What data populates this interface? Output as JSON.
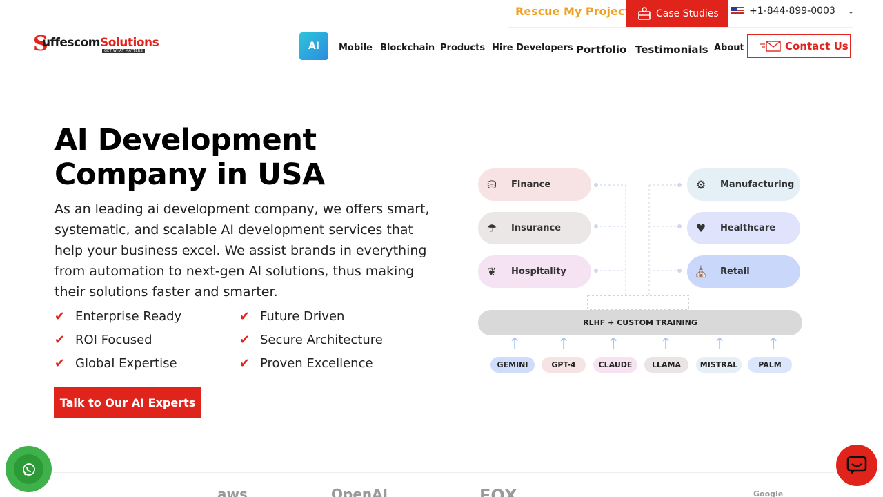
{
  "topbar": {
    "rescue_label": "Rescue My Project",
    "case_studies_label": "Case Studies",
    "phone": "+1-844-899-0003"
  },
  "logo": {
    "s": "S",
    "name": "uffescom",
    "name_accent": "Solutions",
    "tagline": "GET WHAT MATTERS"
  },
  "nav": {
    "ai": "AI",
    "mobile": "Mobile",
    "blockchain": "Blockchain",
    "products": "Products",
    "hire": "Hire Developers",
    "portfolio": "Portfolio",
    "testimonials": "Testimonials",
    "about": "About",
    "contact": "Contact Us"
  },
  "hero": {
    "title": "AI Development Company in USA",
    "description": "As an leading ai development company, we offers smart, systematic, and scalable AI development services that help your business excel. We assist brands in everything from automation to next-gen AI solutions, thus making their solutions faster and smarter.",
    "features": [
      "Enterprise Ready",
      "Future Driven",
      "ROI Focused",
      "Secure Architecture",
      "Global Expertise",
      "Proven Excellence"
    ],
    "cta": "Talk to Our AI Experts"
  },
  "diagram": {
    "left": [
      {
        "label": "Finance",
        "icon": "coins-icon",
        "color": "#f7e3e3"
      },
      {
        "label": "Insurance",
        "icon": "umbrella-icon",
        "color": "#ebe7e7"
      },
      {
        "label": "Hospitality",
        "icon": "hands-icon",
        "color": "#f5e3f3"
      }
    ],
    "right": [
      {
        "label": "Manufacturing",
        "icon": "factory-icon",
        "color": "#e5eff6"
      },
      {
        "label": "Healthcare",
        "icon": "heart-pulse-icon",
        "color": "#dfe3fb"
      },
      {
        "label": "Retail",
        "icon": "store-icon",
        "color": "#c9d7fb"
      }
    ],
    "training": "RLHF + CUSTOM TRAINING",
    "models": [
      {
        "label": "GEMINI",
        "color": "#cfdcfa"
      },
      {
        "label": "GPT-4",
        "color": "#f6e4e4"
      },
      {
        "label": "CLAUDE",
        "color": "#f7e2f2"
      },
      {
        "label": "LLAMA",
        "color": "#ebe4e4"
      },
      {
        "label": "MISTRAL",
        "color": "#e6eff6"
      },
      {
        "label": "PALM",
        "color": "#dbe5fb"
      }
    ]
  },
  "partners": [
    "aws",
    "OpenAI",
    "FOX",
    "Google"
  ],
  "colors": {
    "brand_red": "#e0241b",
    "rescue_orange": "#f0a020",
    "ai_gradient_start": "#2ec5d8",
    "whatsapp_green": "#3fb14a"
  }
}
